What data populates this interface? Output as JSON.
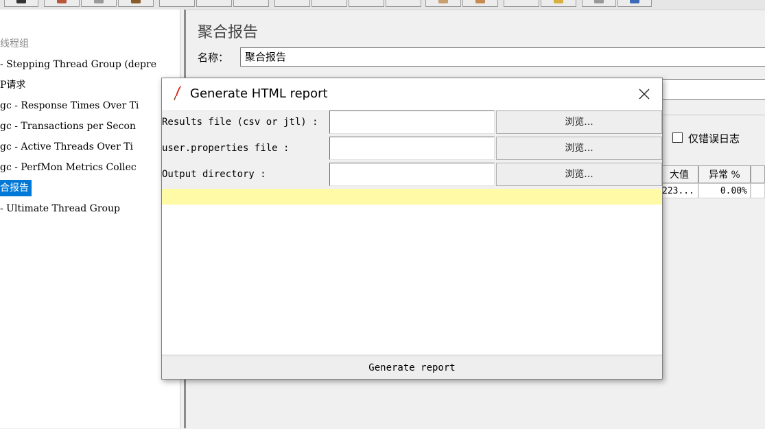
{
  "tree": {
    "items": [
      {
        "label": "线程组"
      },
      {
        "label": "- Stepping Thread Group (depre"
      },
      {
        "label": "P请求"
      },
      {
        "label": "gc - Response Times Over Ti"
      },
      {
        "label": "gc - Transactions per Secon"
      },
      {
        "label": "gc - Active Threads Over Ti"
      },
      {
        "label": "gc - PerfMon Metrics Collec"
      },
      {
        "label": "合报告"
      },
      {
        "label": "- Ultimate Thread Group"
      }
    ]
  },
  "panel": {
    "title": "聚合报告",
    "name_label": "名称：",
    "name_value": "聚合报告",
    "errors_only_label": "仅错误日志",
    "table": {
      "headers": [
        "大值",
        "异常 %"
      ],
      "row": [
        "223...",
        "0.00%"
      ]
    }
  },
  "dialog": {
    "title": "Generate HTML report",
    "fields": [
      {
        "label": "Results file (csv or jtl) :",
        "value": "",
        "browse": "浏览..."
      },
      {
        "label": "user.properties file :",
        "value": "",
        "browse": "浏览..."
      },
      {
        "label": "Output directory :",
        "value": "",
        "browse": "浏览..."
      }
    ],
    "message": "",
    "generate_label": "Generate report"
  },
  "colors": {
    "selection": "#0078d7",
    "message_bar": "#fffaa6",
    "title_icon": "#d8342a"
  }
}
